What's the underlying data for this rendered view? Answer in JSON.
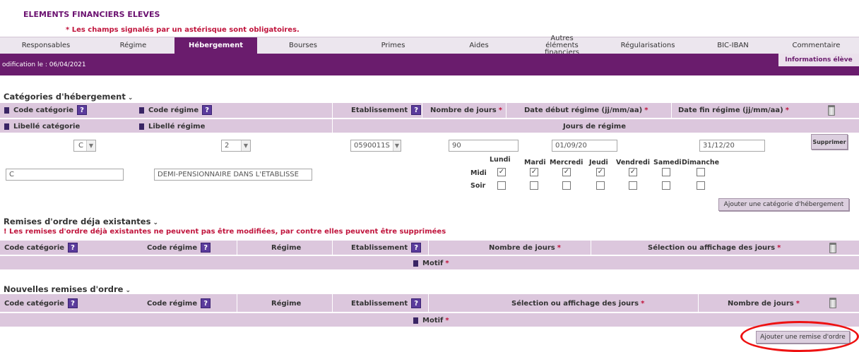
{
  "header": {
    "title": "ELEMENTS FINANCIERS ELEVES",
    "mandatory_note": "* Les champs signalés par un astérisque sont obligatoires."
  },
  "tabs": [
    {
      "label": "Responsables"
    },
    {
      "label": "Régime"
    },
    {
      "label": "Hébergement",
      "active": true
    },
    {
      "label": "Bourses"
    },
    {
      "label": "Primes"
    },
    {
      "label": "Aides"
    },
    {
      "label": "Autres éléments financiers"
    },
    {
      "label": "Régularisations"
    },
    {
      "label": "BIC-IBAN"
    },
    {
      "label": "Commentaire"
    }
  ],
  "status_bar": {
    "modification": "odification le : 06/04/2021",
    "info_button": "Informations élève"
  },
  "hebergement": {
    "title": "Catégories d'hébergement",
    "headers": {
      "code_categorie": "Code catégorie",
      "code_regime": "Code régime",
      "etablissement": "Etablissement",
      "nombre_jours": "Nombre de jours",
      "date_debut": "Date début régime (jj/mm/aa)",
      "date_fin": "Date fin régime (jj/mm/aa)",
      "libelle_categorie": "Libellé catégorie",
      "libelle_regime": "Libellé régime",
      "jours_regime": "Jours de régime"
    },
    "values": {
      "code_categorie": "C",
      "code_regime": "2",
      "etablissement": "0590011S",
      "nombre_jours": "90",
      "date_debut": "01/09/20",
      "date_fin": "31/12/20",
      "libelle_categorie": "C",
      "libelle_regime": "DEMI-PENSIONNAIRE DANS L'ETABLISSE"
    },
    "days": [
      "Lundi",
      "Mardi",
      "Mercredi",
      "Jeudi",
      "Vendredi",
      "Samedi",
      "Dimanche"
    ],
    "rows": [
      {
        "label": "Midi",
        "checked": [
          true,
          true,
          true,
          true,
          true,
          false,
          false
        ]
      },
      {
        "label": "Soir",
        "checked": [
          false,
          false,
          false,
          false,
          false,
          false,
          false
        ]
      }
    ],
    "delete_button": "Supprimer",
    "add_button": "Ajouter une catégorie d'hébergement"
  },
  "remises_existantes": {
    "title": "Remises d'ordre déja existantes",
    "warning": "! Les remises d'ordre déjà existantes ne peuvent pas être modifiées, par contre elles peuvent être supprimées",
    "headers": {
      "code_categorie": "Code catégorie",
      "code_regime": "Code régime",
      "regime": "Régime",
      "etablissement": "Etablissement",
      "nombre_jours": "Nombre de jours",
      "selection": "Sélection ou affichage des jours",
      "motif": "Motif"
    }
  },
  "nouvelles_remises": {
    "title": "Nouvelles remises d'ordre",
    "headers": {
      "code_categorie": "Code catégorie",
      "code_regime": "Code régime",
      "regime": "Régime",
      "etablissement": "Etablissement",
      "selection": "Sélection ou affichage des jours",
      "nombre_jours": "Nombre de jours",
      "motif": "Motif"
    },
    "add_button": "Ajouter une remise d'ordre"
  },
  "icons": {
    "help": "?",
    "chevron": "⌄",
    "star": "*",
    "check": "✓",
    "select_arrow": "▼"
  },
  "colors": {
    "brand_purple": "#6a1c6d",
    "header_row": "#dcc7dd",
    "warning_red": "#c0143c",
    "highlight_red": "#e11111"
  }
}
